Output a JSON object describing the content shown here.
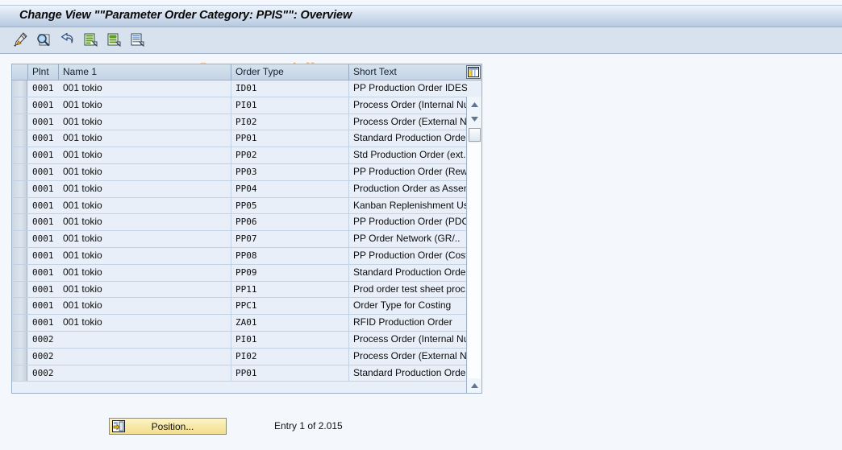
{
  "window": {
    "title": "Change View \"\"Parameter Order Category: PPIS\"\": Overview"
  },
  "watermark": {
    "text": "© www.tutorialkart.com",
    "color": "#e8b98a"
  },
  "toolbar": {
    "buttons": [
      {
        "name": "change-entry-icon",
        "label": "Change entry"
      },
      {
        "name": "display-details-icon",
        "label": "Display details"
      },
      {
        "name": "back-undo-icon",
        "label": "Undo"
      },
      {
        "name": "new-entries-icon",
        "label": "New entries"
      },
      {
        "name": "copy-as-icon",
        "label": "Copy as"
      },
      {
        "name": "details-list-icon",
        "label": "Details"
      }
    ]
  },
  "table": {
    "columns": [
      {
        "key": "plnt",
        "label": "Plnt"
      },
      {
        "key": "name",
        "label": "Name 1"
      },
      {
        "key": "otype",
        "label": "Order Type"
      },
      {
        "key": "stext",
        "label": "Short Text"
      }
    ],
    "column_config_icon": "column-settings-icon",
    "rows": [
      {
        "plnt": "0001",
        "name": "001 tokio",
        "otype": "ID01",
        "stext": "PP Production Order IDES  .."
      },
      {
        "plnt": "0001",
        "name": "001 tokio",
        "otype": "PI01",
        "stext": "Process Order (Internal Nu..."
      },
      {
        "plnt": "0001",
        "name": "001 tokio",
        "otype": "PI02",
        "stext": "Process Order (External Nu..."
      },
      {
        "plnt": "0001",
        "name": "001 tokio",
        "otype": "PP01",
        "stext": "Standard Production Order ."
      },
      {
        "plnt": "0001",
        "name": "001 tokio",
        "otype": "PP02",
        "stext": "Std Production Order (ext...."
      },
      {
        "plnt": "0001",
        "name": "001 tokio",
        "otype": "PP03",
        "stext": "PP Production Order (Rew..."
      },
      {
        "plnt": "0001",
        "name": "001 tokio",
        "otype": "PP04",
        "stext": "Production Order as Assem..."
      },
      {
        "plnt": "0001",
        "name": "001 tokio",
        "otype": "PP05",
        "stext": "Kanban Replenishment Usin..."
      },
      {
        "plnt": "0001",
        "name": "001 tokio",
        "otype": "PP06",
        "stext": "PP Production Order (PDC)..."
      },
      {
        "plnt": "0001",
        "name": "001 tokio",
        "otype": "PP07",
        "stext": "PP Order Network     (GR/.."
      },
      {
        "plnt": "0001",
        "name": "001 tokio",
        "otype": "PP08",
        "stext": "PP Production Order  (Cost.."
      },
      {
        "plnt": "0001",
        "name": "001 tokio",
        "otype": "PP09",
        "stext": "Standard Production Order ."
      },
      {
        "plnt": "0001",
        "name": "001 tokio",
        "otype": "PP11",
        "stext": "Prod order test sheet proc..."
      },
      {
        "plnt": "0001",
        "name": "001 tokio",
        "otype": "PPC1",
        "stext": "Order Type for Costing"
      },
      {
        "plnt": "0001",
        "name": "001 tokio",
        "otype": "ZA01",
        "stext": "RFID Production Order"
      },
      {
        "plnt": "0002",
        "name": "",
        "otype": "PI01",
        "stext": "Process Order (Internal Nu..."
      },
      {
        "plnt": "0002",
        "name": "",
        "otype": "PI02",
        "stext": "Process Order (External Nu..."
      },
      {
        "plnt": "0002",
        "name": "",
        "otype": "PP01",
        "stext": "Standard Production Order ."
      }
    ]
  },
  "footer": {
    "position_button_label": "Position...",
    "position_button_icon": "position-icon",
    "entry_status": "Entry 1 of 2.015"
  }
}
